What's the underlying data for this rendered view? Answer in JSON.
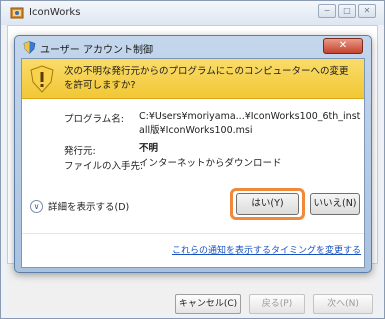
{
  "outer_window": {
    "title": "IconWorks",
    "controls": [
      "−",
      "□",
      "✕"
    ],
    "buttons": {
      "cancel": "キャンセル(C)",
      "back": "戻る(P)",
      "next": "次へ(N)"
    }
  },
  "uac": {
    "title": "ユーザー アカウント制御",
    "close_label": "✕",
    "question": "次の不明な発行元からのプログラムにこのコンピューターへの変更を許可しますか?",
    "program_label": "プログラム名:",
    "program_value": "C:¥Users¥moriyama...¥IconWorks100_6th_install版¥IconWorks100.msi",
    "publisher_label": "発行元:",
    "publisher_value": "不明",
    "origin_label": "ファイルの入手先:",
    "origin_value": "インターネットからダウンロード",
    "details_label": "詳細を表示する(D)",
    "yes_label": "はい(Y)",
    "no_label": "いいえ(N)",
    "link_text": "これらの通知を表示するタイミングを変更する"
  },
  "colors": {
    "banner": "#f2c735",
    "highlight": "#f08a3a",
    "link": "#1a52c2",
    "close": "#c4432b"
  }
}
